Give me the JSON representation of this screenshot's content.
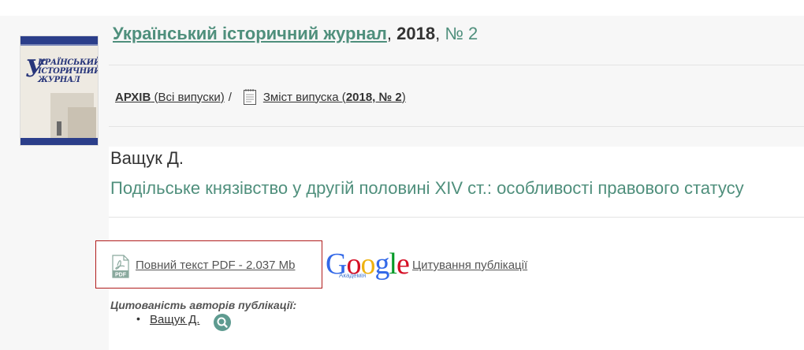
{
  "journal": {
    "title_link": "Український історичний журнал",
    "comma1": ",",
    "year": "2018",
    "comma2": ",",
    "issue_link": "№ 2"
  },
  "cover": {
    "letter": "У",
    "line1": "КРАЇНСЬКИЙ",
    "line2": "ІСТОРИЧНИЙ",
    "line3": "ЖУРНАЛ"
  },
  "breadcrumb": {
    "archive_bold": "АРХІВ",
    "archive_rest": " (Всі випуски)",
    "separator": "/",
    "contents_prefix": "Зміст випуска (",
    "contents_bold": "2018, № 2",
    "contents_suffix": ")"
  },
  "article": {
    "author": "Ващук Д.",
    "title": "Подільське князівство у другій половині XIV ст.: особливості правового статусу"
  },
  "fulltext": {
    "icon_text": "PDF",
    "link_label": " Повний текст PDF - 2.037 Mb"
  },
  "google": {
    "letters": [
      "G",
      "o",
      "o",
      "g",
      "l",
      "e"
    ],
    "colors": [
      "#3369e8",
      "#d50f25",
      "#eeb211",
      "#3369e8",
      "#009925",
      "#d50f25"
    ],
    "subtitle": "Академія",
    "cite_link": "Цитування публікації"
  },
  "citations": {
    "label": "Цитованість авторів публікації:",
    "bullet": "•",
    "authors": [
      "Ващук Д."
    ]
  }
}
